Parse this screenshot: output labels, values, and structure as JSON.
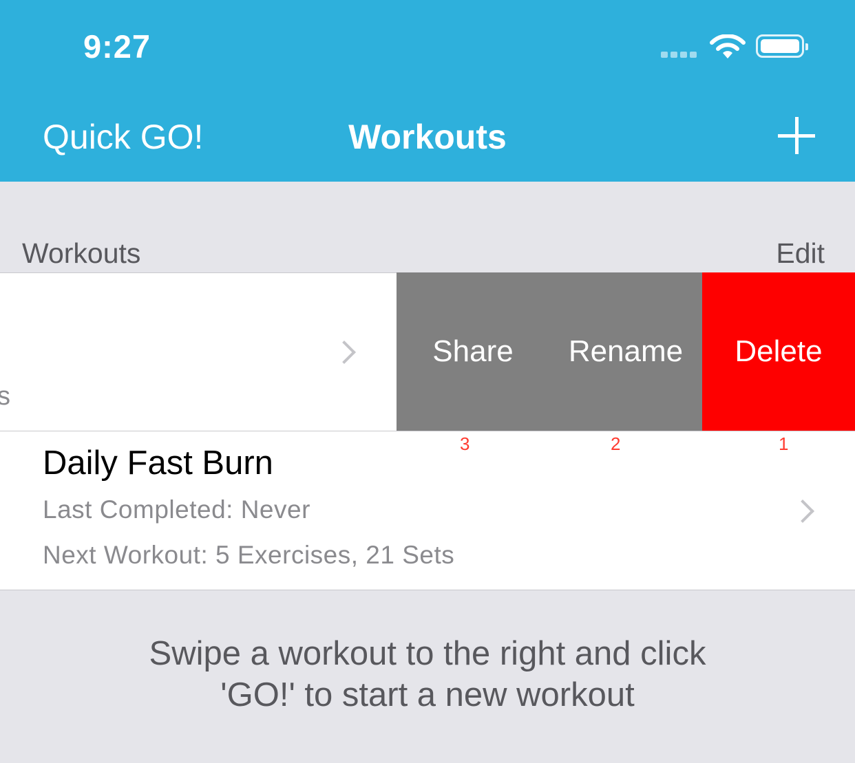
{
  "status_bar": {
    "time": "9:27"
  },
  "nav": {
    "left_button": "Quick GO!",
    "title": "Workouts",
    "add_icon": "plus-icon"
  },
  "section": {
    "header": "Workouts",
    "edit": "Edit"
  },
  "swiped_row": {
    "partial_text": "s",
    "actions": [
      {
        "label": "Share",
        "color": "#808080",
        "badge": "3"
      },
      {
        "label": "Rename",
        "color": "#808080",
        "badge": "2"
      },
      {
        "label": "Delete",
        "color": "#fe0000",
        "badge": "1"
      }
    ]
  },
  "workout": {
    "title": "Daily Fast Burn",
    "last_completed": "Last Completed: Never",
    "next_workout": "Next Workout: 5 Exercises, 21 Sets"
  },
  "footer": {
    "line1": "Swipe a workout to the right and click",
    "line2": "'GO!' to start a new workout"
  },
  "colors": {
    "header": "#2eb0dc",
    "background": "#e5e5ea",
    "delete": "#fe0000",
    "action_gray": "#808080"
  }
}
